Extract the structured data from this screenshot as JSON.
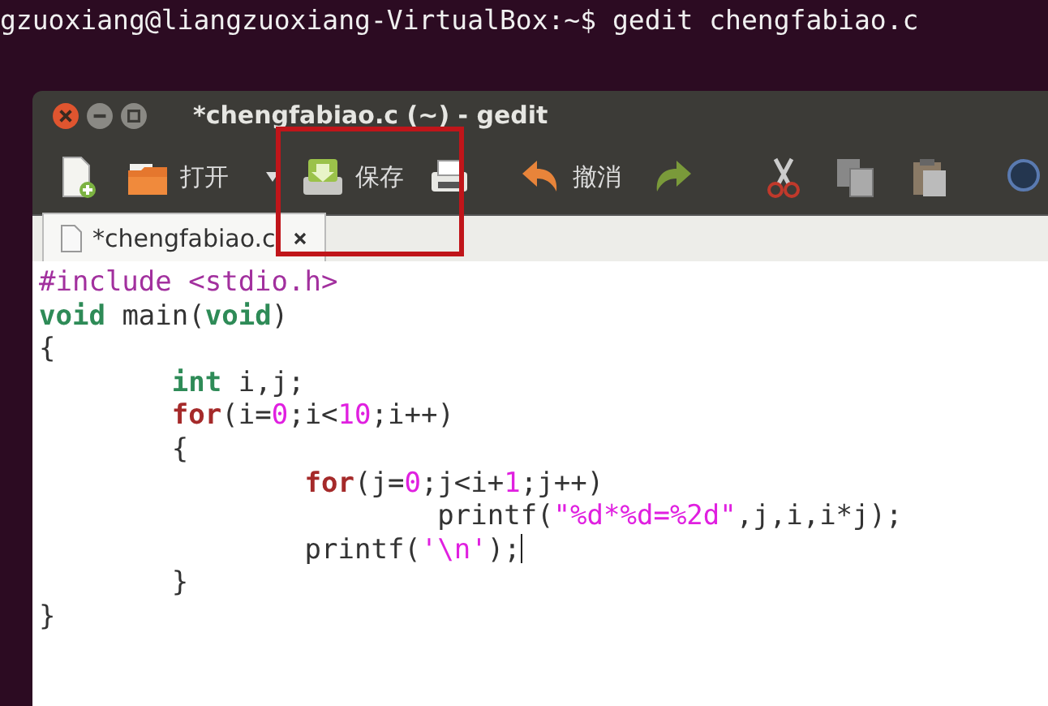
{
  "terminal": {
    "prompt_line": "gzuoxiang@liangzuoxiang-VirtualBox:~$ gedit chengfabiao.c"
  },
  "window": {
    "title": "*chengfabiao.c (~) - gedit"
  },
  "toolbar": [
    {
      "kind": "new"
    },
    {
      "kind": "open",
      "label": "打开"
    },
    {
      "kind": "dropdown"
    },
    {
      "kind": "save",
      "label": "保存",
      "highlighted": true
    },
    {
      "kind": "print"
    },
    {
      "kind": "undo",
      "label": "撤消"
    },
    {
      "kind": "redo"
    },
    {
      "kind": "cut"
    },
    {
      "kind": "copy"
    },
    {
      "kind": "paste"
    },
    {
      "kind": "search"
    }
  ],
  "tabs": [
    {
      "label": "*chengfabiao.c",
      "selected": true
    }
  ],
  "code_lines": [
    {
      "tokens": [
        {
          "kind": "preproc",
          "text": "#include <stdio.h>"
        }
      ]
    },
    {
      "tokens": [
        {
          "kind": "type",
          "text": "void"
        },
        {
          "kind": "plain",
          "text": " main("
        },
        {
          "kind": "type",
          "text": "void"
        },
        {
          "kind": "plain",
          "text": ")"
        }
      ]
    },
    {
      "tokens": [
        {
          "kind": "plain",
          "text": "{"
        }
      ]
    },
    {
      "tokens": [
        {
          "kind": "type",
          "text": "\tint"
        },
        {
          "kind": "plain",
          "text": " i,j;"
        }
      ]
    },
    {
      "tokens": [
        {
          "kind": "keyword",
          "text": "\tfor"
        },
        {
          "kind": "plain",
          "text": "(i="
        },
        {
          "kind": "number",
          "text": "0"
        },
        {
          "kind": "plain",
          "text": ";i<"
        },
        {
          "kind": "number",
          "text": "10"
        },
        {
          "kind": "plain",
          "text": ";i++)"
        }
      ]
    },
    {
      "tokens": [
        {
          "kind": "plain",
          "text": "\t{"
        }
      ]
    },
    {
      "tokens": [
        {
          "kind": "keyword",
          "text": "\t\tfor"
        },
        {
          "kind": "plain",
          "text": "(j="
        },
        {
          "kind": "number",
          "text": "0"
        },
        {
          "kind": "plain",
          "text": ";j<i+"
        },
        {
          "kind": "number",
          "text": "1"
        },
        {
          "kind": "plain",
          "text": ";j++)"
        }
      ]
    },
    {
      "tokens": [
        {
          "kind": "plain",
          "text": "\t\t\tprintf("
        },
        {
          "kind": "string",
          "text": "\"%d*%d=%2d\""
        },
        {
          "kind": "plain",
          "text": ",j,i,i*j);"
        }
      ]
    },
    {
      "tokens": [
        {
          "kind": "plain",
          "text": "\t\tprintf("
        },
        {
          "kind": "string",
          "text": "'\\n'"
        },
        {
          "kind": "plain",
          "text": ");"
        }
      ],
      "cursor": true
    },
    {
      "tokens": [
        {
          "kind": "plain",
          "text": "\t}"
        }
      ]
    },
    {
      "tokens": [
        {
          "kind": "plain",
          "text": "}"
        }
      ]
    }
  ]
}
